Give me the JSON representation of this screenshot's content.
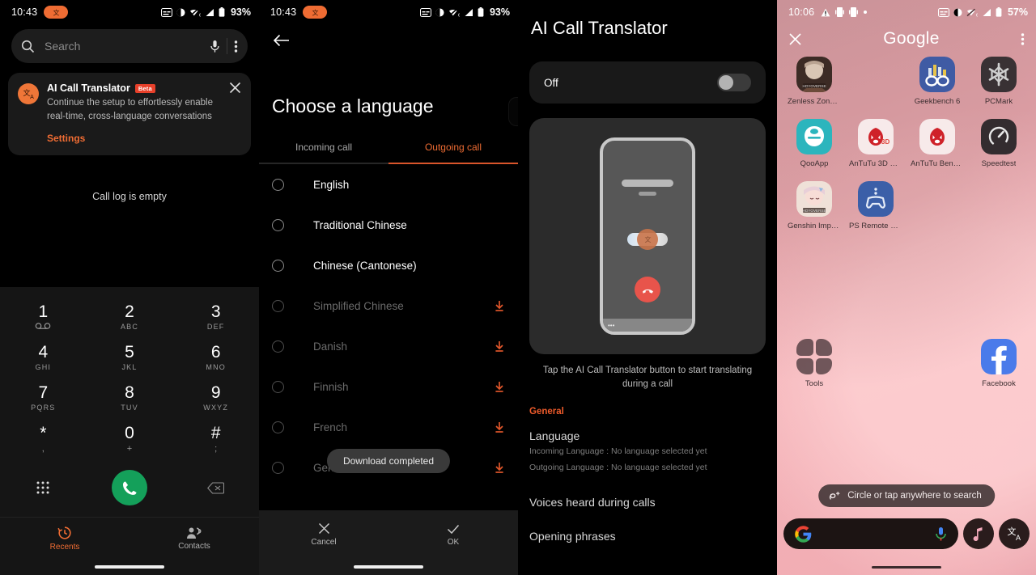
{
  "panel1": {
    "name": "phone-dialer",
    "statusbar": {
      "time": "10:43",
      "battery": "93%",
      "wifi_gen": "6",
      "icons": [
        "captions-icon",
        "dnd-icon",
        "wifi-off-icon",
        "signal-icon",
        "battery-icon"
      ]
    },
    "search": {
      "placeholder": "Search",
      "mic": "mic-icon",
      "overflow": "more-vert-icon"
    },
    "promo": {
      "title": "AI Call Translator",
      "badge": "Beta",
      "description": "Continue the setup to effortlessly enable real-time, cross-language conversations",
      "action": "Settings",
      "close": "close-icon"
    },
    "call_log_empty": "Call log is empty",
    "dialpad": [
      {
        "num": "1",
        "sub": "⊙⊙",
        "sub_type": "voicemail"
      },
      {
        "num": "2",
        "sub": "ABC"
      },
      {
        "num": "3",
        "sub": "DEF"
      },
      {
        "num": "4",
        "sub": "GHI"
      },
      {
        "num": "5",
        "sub": "JKL"
      },
      {
        "num": "6",
        "sub": "MNO"
      },
      {
        "num": "7",
        "sub": "PQRS"
      },
      {
        "num": "8",
        "sub": "TUV"
      },
      {
        "num": "9",
        "sub": "WXYZ"
      },
      {
        "num": "*",
        "sub": ","
      },
      {
        "num": "0",
        "sub": "+"
      },
      {
        "num": "#",
        "sub": ";"
      }
    ],
    "actions": {
      "keypad": "keypad-icon",
      "call": "call-icon",
      "backspace": "backspace-icon"
    },
    "nav": [
      {
        "label": "Recents",
        "icon": "history-icon",
        "active": true
      },
      {
        "label": "Contacts",
        "icon": "contacts-icon",
        "active": false
      }
    ]
  },
  "panel2": {
    "name": "choose-language",
    "statusbar": {
      "time": "10:43",
      "battery": "93%",
      "wifi_gen": "6"
    },
    "back": "back-arrow-icon",
    "title": "Choose a language",
    "tabs": [
      {
        "label": "Incoming call",
        "active": false
      },
      {
        "label": "Outgoing call",
        "active": true
      }
    ],
    "languages": [
      {
        "label": "English",
        "installed": true
      },
      {
        "label": "Traditional Chinese",
        "installed": true
      },
      {
        "label": "Chinese (Cantonese)",
        "installed": true
      },
      {
        "label": "Simplified Chinese",
        "installed": false
      },
      {
        "label": "Danish",
        "installed": false
      },
      {
        "label": "Finnish",
        "installed": false
      },
      {
        "label": "French",
        "installed": false
      },
      {
        "label": "German",
        "installed": false
      }
    ],
    "toast": "Download completed",
    "footer": [
      {
        "label": "Cancel",
        "icon": "close-icon"
      },
      {
        "label": "OK",
        "icon": "check-icon"
      }
    ]
  },
  "panel3": {
    "name": "ai-call-translator-settings",
    "title": "AI Call Translator",
    "toggle": {
      "label": "Off",
      "state": "off"
    },
    "illustration_caption": "Tap the AI Call Translator button to start translating during a call",
    "section_header": "General",
    "settings": [
      {
        "title": "Language",
        "sub1": "Incoming Language : No language selected yet",
        "sub2": "Outgoing Language : No language selected yet"
      },
      {
        "title": "Voices heard during calls"
      },
      {
        "title": "Opening phrases"
      }
    ]
  },
  "panel4": {
    "name": "home-screen-folder",
    "statusbar": {
      "time": "10:06",
      "battery": "57%",
      "wifi_gen": "6",
      "icons": [
        "warning-icon",
        "cast-icon",
        "cast-icon",
        "dot-icon",
        "captions-icon",
        "dnd-icon",
        "wifi-off-icon",
        "signal-icon",
        "battery-icon"
      ]
    },
    "header": {
      "close": "close-icon",
      "title": "Google",
      "overflow": "more-vert-icon"
    },
    "apps": [
      {
        "label": "Zenless Zone Z...",
        "icon": "zenless-zone-zero-icon"
      },
      {
        "label": "",
        "icon": "empty-slot"
      },
      {
        "label": "Geekbench 6",
        "icon": "geekbench-icon"
      },
      {
        "label": "PCMark",
        "icon": "pcmark-icon"
      },
      {
        "label": "QooApp",
        "icon": "qooapp-icon"
      },
      {
        "label": "AnTuTu 3D Ben..",
        "icon": "antutu-3d-icon"
      },
      {
        "label": "AnTuTu Bench..",
        "icon": "antutu-icon"
      },
      {
        "label": "Speedtest",
        "icon": "speedtest-icon"
      },
      {
        "label": "Genshin Impact",
        "icon": "genshin-impact-icon"
      },
      {
        "label": "PS Remote Play",
        "icon": "ps-remote-play-icon"
      }
    ],
    "desktop_apps": [
      {
        "label": "Tools",
        "icon": "folder-icon"
      },
      {
        "label": "Facebook",
        "icon": "facebook-icon"
      }
    ],
    "circle_to_search": {
      "label": "Circle or tap anywhere to search",
      "icon": "circle-search-icon"
    },
    "dock": {
      "google_icon": "google-g-icon",
      "mic_icon": "mic-icon",
      "music_icon": "music-note-icon",
      "translate_icon": "translate-icon"
    }
  },
  "colors": {
    "accent_orange": "#ef6c33",
    "accent_orange_dark": "#d9552b",
    "call_green": "#14a05a",
    "end_call_red": "#e8544b",
    "beta_red": "#e8402a",
    "surface_dark": "#1a1a1a",
    "home_pink": "#f0adb4"
  }
}
